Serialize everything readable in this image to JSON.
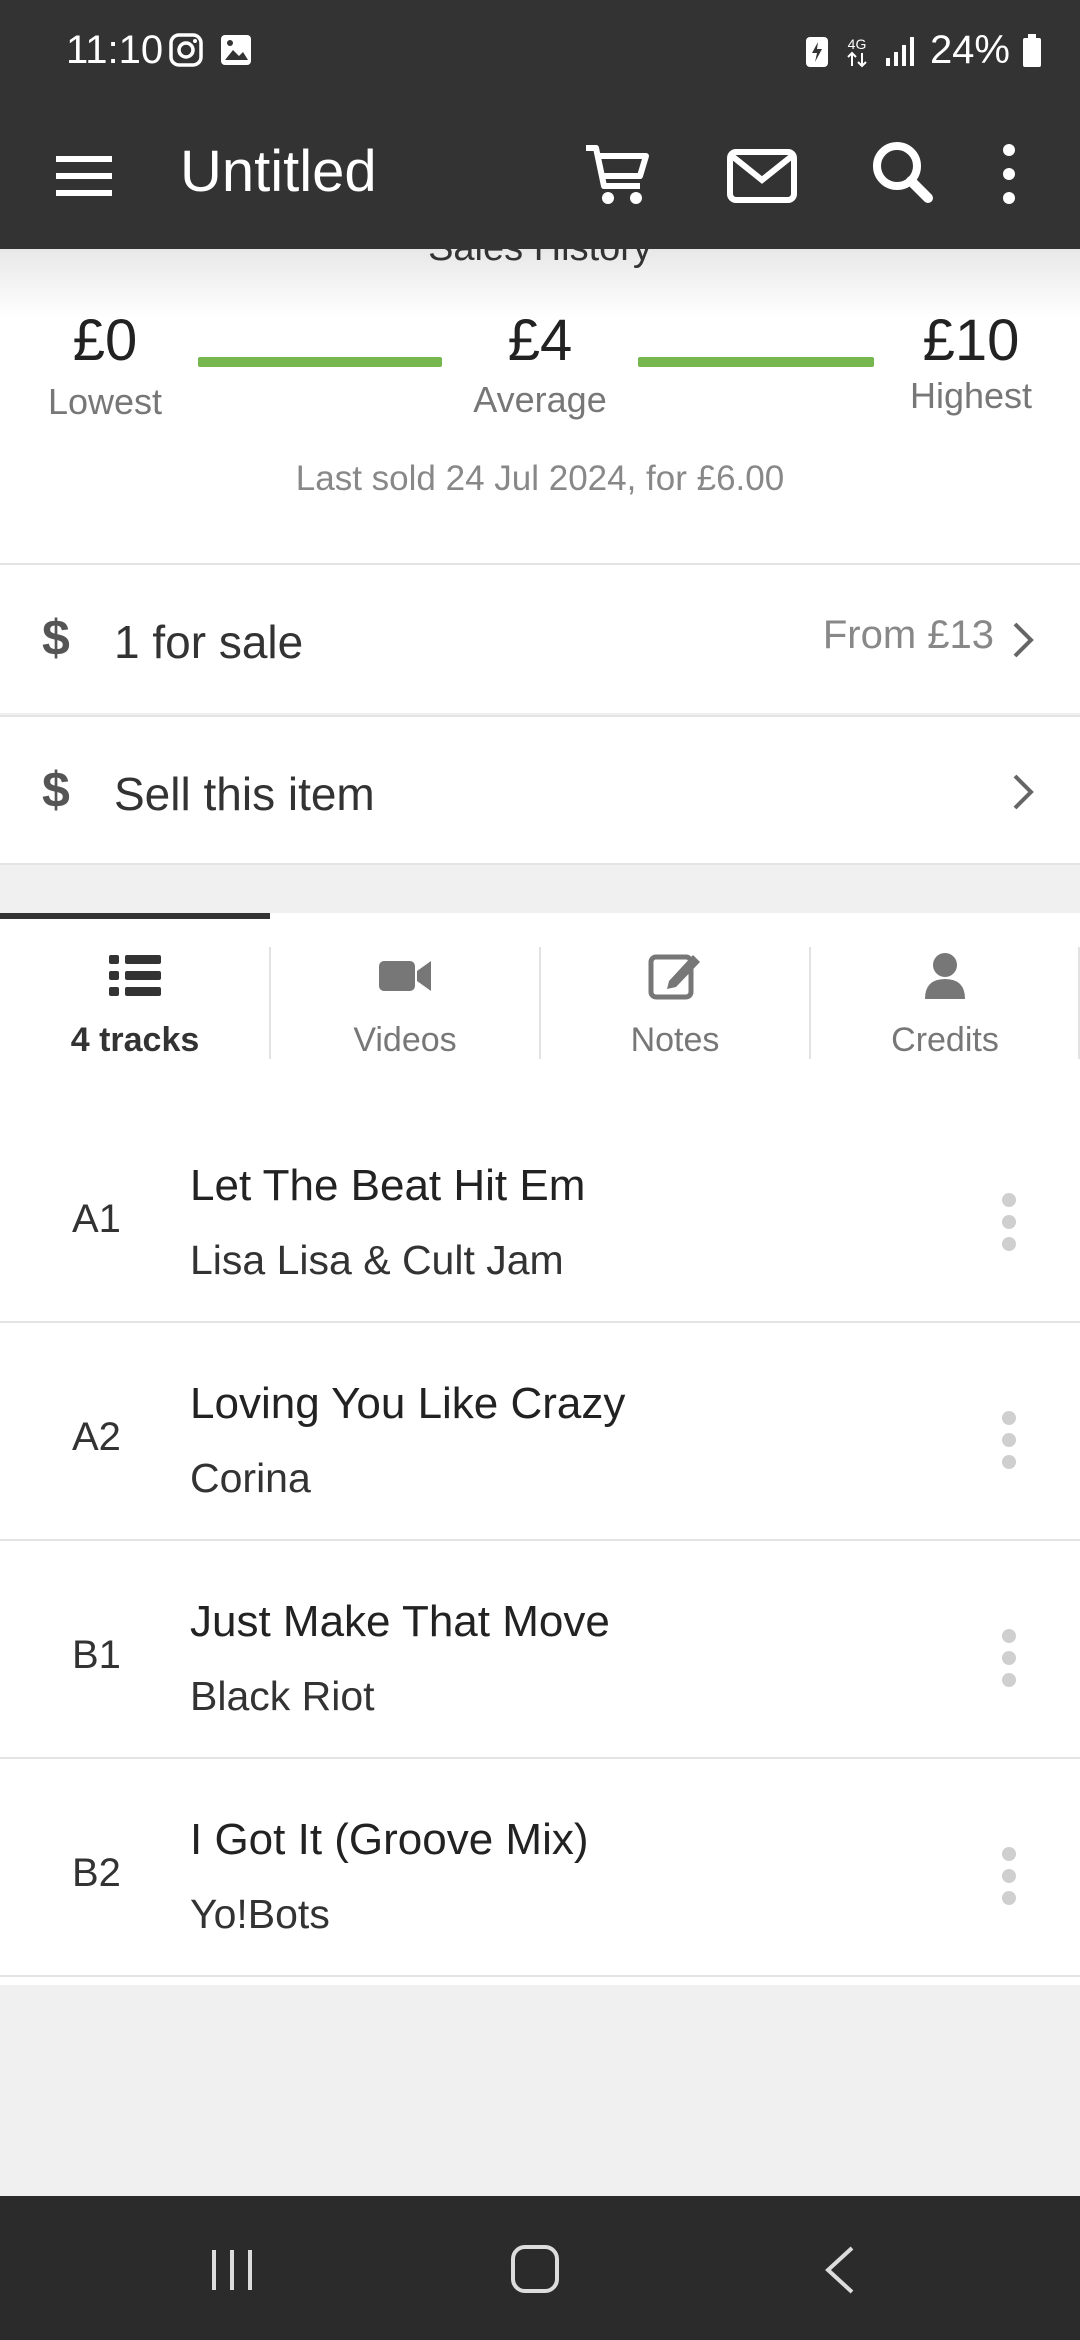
{
  "status_bar": {
    "time": "11:10",
    "battery_percent": "24%",
    "network": "4G",
    "icons": [
      "instagram-icon",
      "gallery-icon",
      "battery-saver-icon",
      "network-4g-icon",
      "signal-icon",
      "battery-icon"
    ]
  },
  "app_bar": {
    "title": "Untitled",
    "icons": [
      "menu-icon",
      "cart-icon",
      "mail-icon",
      "search-icon",
      "more-vertical-icon"
    ]
  },
  "sales_history": {
    "heading": "Sales History",
    "lowest_value": "£0",
    "lowest_label": "Lowest",
    "average_value": "£4",
    "average_label": "Average",
    "highest_value": "£10",
    "highest_label": "Highest",
    "last_sold": "Last sold 24 Jul 2024, for £6.00"
  },
  "for_sale": {
    "icon": "dollar-icon",
    "label": "1 for sale",
    "price": "From £13"
  },
  "sell_item": {
    "icon": "dollar-icon",
    "label": "Sell this item"
  },
  "tabs": [
    {
      "label": "4 tracks",
      "icon": "list-icon",
      "active": true
    },
    {
      "label": "Videos",
      "icon": "video-camera-icon",
      "active": false
    },
    {
      "label": "Notes",
      "icon": "edit-note-icon",
      "active": false
    },
    {
      "label": "Credits",
      "icon": "person-icon",
      "active": false
    }
  ],
  "tracks": [
    {
      "position": "A1",
      "title": "Let The Beat Hit Em",
      "artist": "Lisa Lisa & Cult Jam"
    },
    {
      "position": "A2",
      "title": "Loving You Like Crazy",
      "artist": "Corina"
    },
    {
      "position": "B1",
      "title": "Just Make That Move",
      "artist": "Black Riot"
    },
    {
      "position": "B2",
      "title": "I Got It (Groove Mix)",
      "artist": "Yo!Bots"
    }
  ],
  "colors": {
    "app_bar": "#333333",
    "price_bar": "#76b84f",
    "nav_bar": "#2b2b2b"
  }
}
